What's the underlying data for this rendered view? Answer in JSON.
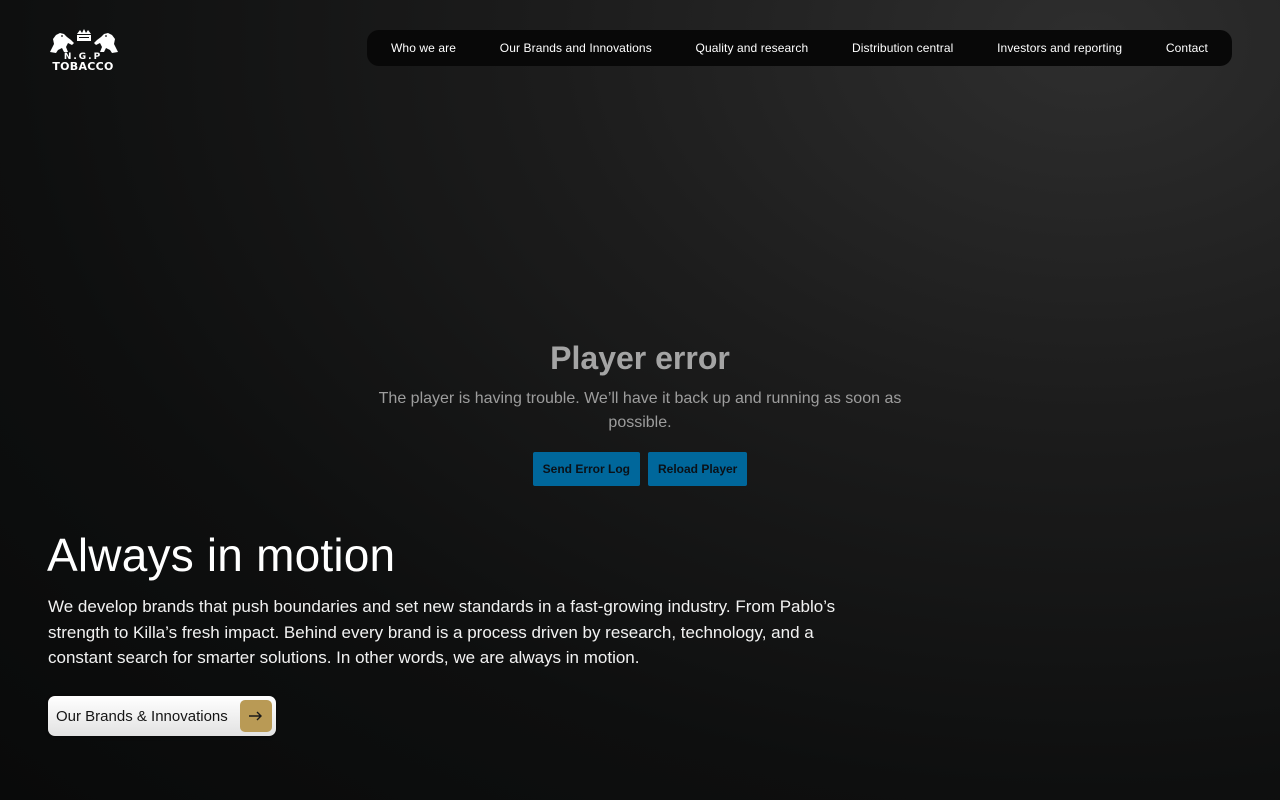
{
  "header": {
    "logo": {
      "icon": "lions-crest-logo-icon",
      "line1": "N.G.P",
      "line2": "TOBACCO"
    },
    "nav": [
      {
        "label": "Who we are"
      },
      {
        "label": "Our Brands and Innovations"
      },
      {
        "label": "Quality and research"
      },
      {
        "label": "Distribution central"
      },
      {
        "label": "Investors and reporting"
      },
      {
        "label": "Contact"
      }
    ]
  },
  "player": {
    "title": "Player error",
    "message": "The player is having trouble. We’ll have it back up and running as soon as possible.",
    "send_log_label": "Send Error Log",
    "reload_label": "Reload Player"
  },
  "hero": {
    "title": "Always in motion",
    "text": "We develop brands that push boundaries and set new standards in a fast-growing industry. From Pablo’s strength to Killa’s fresh impact. Behind every brand is a process driven by research, technology, and a constant search for smarter solutions. In other words, we are always in motion.",
    "cta_label": "Our Brands & Innovations",
    "cta_icon": "arrow-right-icon"
  },
  "colors": {
    "accent_gold": "#b99a55",
    "player_button": "#00679b",
    "nav_background": "#080808"
  }
}
